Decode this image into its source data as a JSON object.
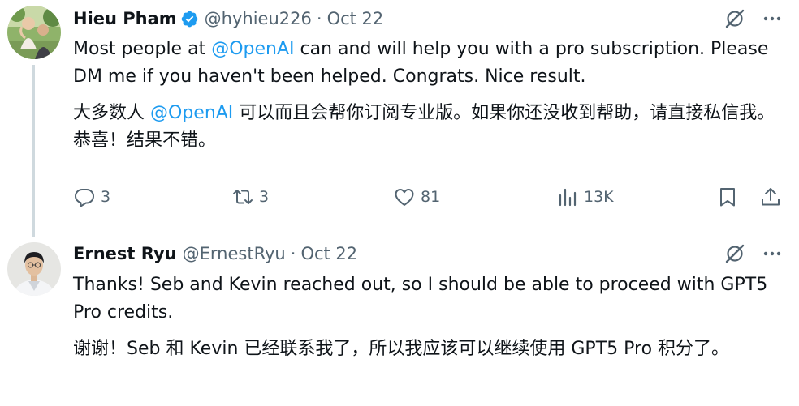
{
  "tweets": [
    {
      "author": {
        "name": "Hieu Pham",
        "handle": "@hyhieu226",
        "verified": true
      },
      "date": "Oct 22",
      "dot": "·",
      "text_en": {
        "before": "Most people at ",
        "mention": "@OpenAI",
        "after": " can and will help you with a pro subscription. Please DM me if you haven't been helped. Congrats. Nice result."
      },
      "text_zh": {
        "before": "大多数人 ",
        "mention": "@OpenAI",
        "after": " 可以而且会帮你订阅专业版。如果你还没收到帮助，请直接私信我。恭喜！结果不错。"
      },
      "stats": {
        "replies": "3",
        "reposts": "3",
        "likes": "81",
        "views": "13K"
      }
    },
    {
      "author": {
        "name": "Ernest Ryu",
        "handle": "@ErnestRyu"
      },
      "date": "Oct 22",
      "dot": "·",
      "text_en": "Thanks! Seb and Kevin reached out, so I should be able to proceed with GPT5 Pro credits.",
      "text_zh": "谢谢！Seb 和 Kevin 已经联系我了，所以我应该可以继续使用 GPT5 Pro 积分了。"
    }
  ],
  "icons": {
    "verified": "verified-badge-icon",
    "grok": "grok-icon",
    "more": "more-dots-icon",
    "reply": "reply-bubble-icon",
    "repost": "repost-arrows-icon",
    "like": "heart-icon",
    "views": "views-bars-icon",
    "bookmark": "bookmark-icon",
    "share": "share-upload-icon"
  },
  "colors": {
    "text": "#0f1419",
    "secondary": "#536471",
    "accent": "#1d9bf0",
    "thread_line": "#cfd9de"
  }
}
